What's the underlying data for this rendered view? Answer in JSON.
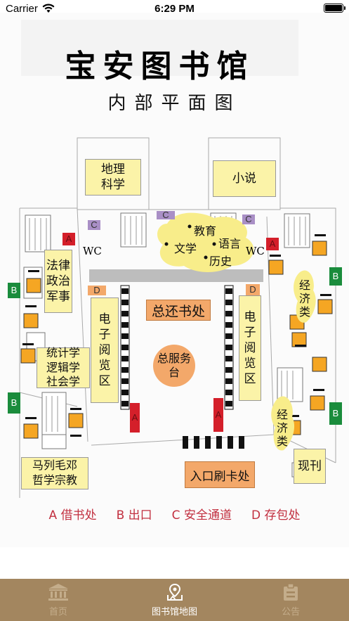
{
  "status_bar": {
    "carrier": "Carrier",
    "time": "6:29 PM"
  },
  "map": {
    "title": "宝安图书馆",
    "subtitle": "内部平面图",
    "rooms": {
      "geography": "地理\n科学",
      "novel": "小说",
      "law": "法律\n政治\n军事",
      "statistics": "统计学\n逻辑学\n社会学",
      "marxism": "马列毛邓\n哲学宗教",
      "return_desk": "总还书处",
      "service_desk": "总服务\n台",
      "e_reading_left": "电子\n阅览区",
      "e_reading_right": "电子\n阅览区",
      "economics_top": "经\n济\n类",
      "economics_bottom": "经\n济\n类",
      "periodicals": "现刊",
      "entrance": "入口刷卡处",
      "education": "教育",
      "literature": "文学",
      "language": "语言",
      "history": "历史"
    },
    "markers": {
      "a": "A",
      "b": "B",
      "c": "C",
      "d": "D",
      "wc": "WC"
    },
    "legend": [
      "A 借书处",
      "B 出口",
      "C 安全通道",
      "D 存包处"
    ]
  },
  "tabs": [
    {
      "label": "首页",
      "icon": "bank-icon",
      "active": false
    },
    {
      "label": "图书馆地图",
      "icon": "map-pin-icon",
      "active": true
    },
    {
      "label": "公告",
      "icon": "clipboard-icon",
      "active": false
    }
  ],
  "colors": {
    "tab_bar": "#a3865f",
    "room_yellow": "#fbf3a8",
    "orange": "#f3a86a",
    "marker_red": "#d41f2a",
    "marker_green": "#1a8c3c",
    "marker_purple": "#a98fc6",
    "legend_text": "#c23040"
  }
}
